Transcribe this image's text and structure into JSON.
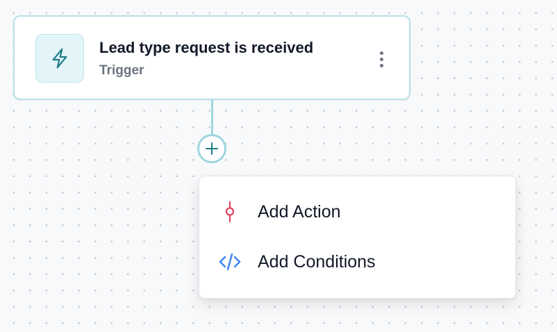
{
  "trigger": {
    "title": "Lead type request is received",
    "subtitle": "Trigger",
    "icon": "lightning-bolt-icon",
    "more_icon": "vertical-ellipsis-icon"
  },
  "add_node": {
    "icon": "plus-icon"
  },
  "add_menu": {
    "items": [
      {
        "label": "Add Action",
        "icon": "commit-node-icon",
        "icon_color": "#e0435b"
      },
      {
        "label": "Add Conditions",
        "icon": "code-brackets-icon",
        "icon_color": "#3b82f6"
      }
    ]
  },
  "colors": {
    "accent_teal": "#1a7a86",
    "connector": "#9ed5de",
    "card_border": "#b5e0e6",
    "icon_bg": "#e3f5f8"
  }
}
